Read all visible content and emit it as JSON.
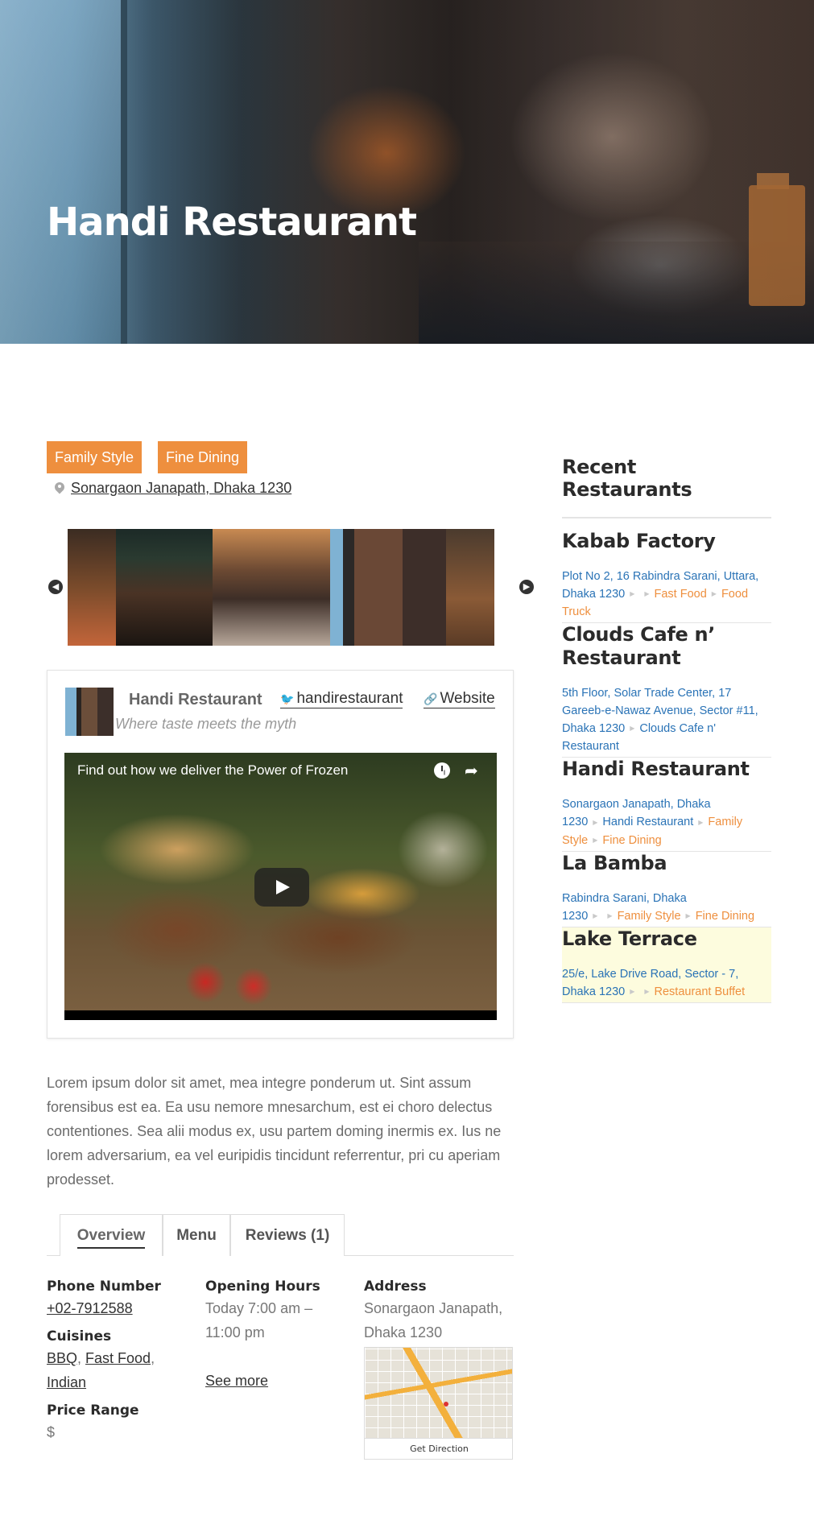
{
  "hero": {
    "title": "Handi Restaurant"
  },
  "categories": [
    "Family Style",
    "Fine Dining"
  ],
  "address": "Sonargaon Janapath, Dhaka 1230",
  "card": {
    "name": "Handi Restaurant",
    "tagline": "Where taste meets the myth",
    "twitter": "handirestaurant",
    "website": "Website",
    "video_title": "Find out how we deliver the Power of Frozen"
  },
  "description": "Lorem ipsum dolor sit amet, mea integre ponderum ut. Sint assum forensibus est ea. Ea usu nemore mnesarchum, est ei choro delectus contentiones. Sea alii modus ex, usu partem doming inermis ex. Ius ne lorem adversarium, ea vel euripidis tincidunt referrentur, pri cu aperiam prodesset.",
  "tabs": [
    "Overview",
    "Menu",
    "Reviews (1)"
  ],
  "details": {
    "phone_label": "Phone Number",
    "phone": "+02-7912588",
    "cuisines_label": "Cuisines",
    "cuisines": [
      "BBQ",
      "Fast Food",
      "Indian"
    ],
    "price_label": "Price Range",
    "price": "$",
    "hours_label": "Opening Hours",
    "hours": "Today 7:00 am – 11:00 pm",
    "see_more": "See more",
    "address_label": "Address",
    "address": "Sonargaon Janapath, Dhaka 1230",
    "get_direction": "Get Direction"
  },
  "sidebar": {
    "title": "Recent Restaurants",
    "items": [
      {
        "name": "Kabab Factory",
        "address": "Plot No 2, 16 Rabindra Sarani, Uttara, Dhaka 1230",
        "tags": [
          "",
          "Fast Food",
          "Food Truck"
        ]
      },
      {
        "name": "Clouds Cafe n’ Restaurant",
        "address": "5th Floor, Solar Trade Center, 17 Gareeb-e-Nawaz Avenue, Sector #11, Dhaka 1230",
        "tags": [
          "Clouds Cafe n' Restaurant"
        ]
      },
      {
        "name": "Handi Restaurant",
        "address": "Sonargaon Janapath, Dhaka 1230",
        "tags": [
          "Handi Restaurant",
          "Family Style",
          "Fine Dining"
        ]
      },
      {
        "name": "La Bamba",
        "address": "Rabindra Sarani, Dhaka 1230",
        "tags": [
          "",
          "Family Style",
          "Fine Dining"
        ]
      },
      {
        "name": "Lake Terrace",
        "address": "25/e, Lake Drive Road, Sector - 7, Dhaka 1230",
        "tags": [
          "",
          "Restaurant Buffet"
        ]
      }
    ]
  },
  "colors": {
    "accent": "#ee8f3e",
    "link": "#2a73b6",
    "heading": "#2b2b2b",
    "highlight": "#fdfcde"
  }
}
